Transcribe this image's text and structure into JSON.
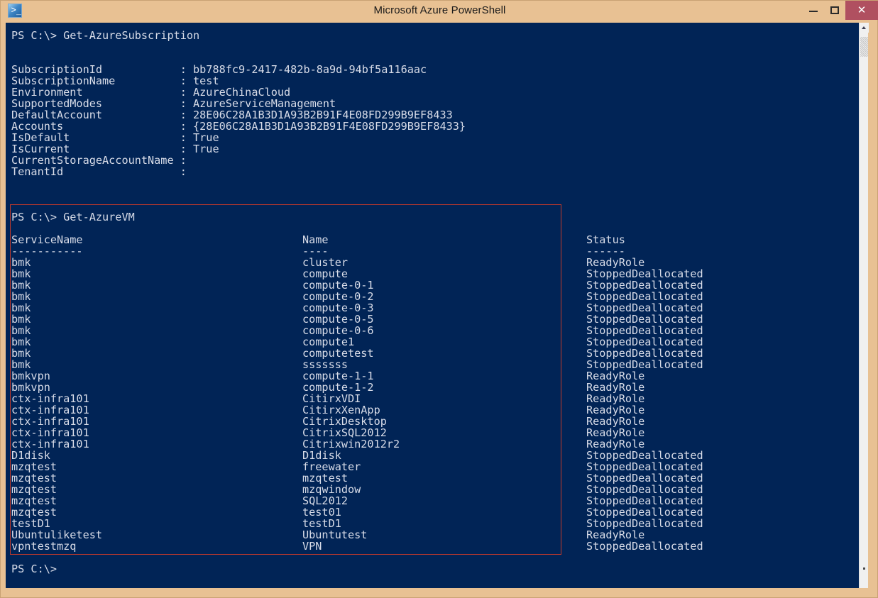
{
  "window": {
    "title": "Microsoft Azure PowerShell",
    "icon": "powershell-icon",
    "minimize_label": "–",
    "maximize_label": "❑",
    "close_label": "✕",
    "colors": {
      "frame": "#e8c193",
      "console_background": "#012456",
      "console_foreground": "#d8dce8",
      "close_button": "#b05060",
      "highlight_box_border": "#c0392b"
    }
  },
  "console": {
    "prompt": "PS C:\\>",
    "blocks": [
      {
        "name": "get-azuresubscription-block",
        "command_line": "PS C:\\> Get-AzureSubscription",
        "properties": [
          {
            "key": "SubscriptionId",
            "separator": ":",
            "value": "bb788fc9-2417-482b-8a9d-94bf5a116aac"
          },
          {
            "key": "SubscriptionName",
            "separator": ":",
            "value": "test"
          },
          {
            "key": "Environment",
            "separator": ":",
            "value": "AzureChinaCloud"
          },
          {
            "key": "SupportedModes",
            "separator": ":",
            "value": "AzureServiceManagement"
          },
          {
            "key": "DefaultAccount",
            "separator": ":",
            "value": "28E06C28A1B3D1A93B2B91F4E08FD299B9EF8433"
          },
          {
            "key": "Accounts",
            "separator": ":",
            "value": "{28E06C28A1B3D1A93B2B91F4E08FD299B9EF8433}"
          },
          {
            "key": "IsDefault",
            "separator": ":",
            "value": "True"
          },
          {
            "key": "IsCurrent",
            "separator": ":",
            "value": "True"
          },
          {
            "key": "CurrentStorageAccountName",
            "separator": ":",
            "value": ""
          },
          {
            "key": "TenantId",
            "separator": ":",
            "value": ""
          }
        ]
      },
      {
        "name": "get-azurevm-block",
        "command_line": "PS C:\\> Get-AzureVM",
        "highlighted": true,
        "table": {
          "headers": [
            "ServiceName",
            "Name",
            "Status"
          ],
          "rules": [
            "-----------",
            "----",
            "------"
          ],
          "rows": [
            [
              "bmk",
              "cluster",
              "ReadyRole"
            ],
            [
              "bmk",
              "compute",
              "StoppedDeallocated"
            ],
            [
              "bmk",
              "compute-0-1",
              "StoppedDeallocated"
            ],
            [
              "bmk",
              "compute-0-2",
              "StoppedDeallocated"
            ],
            [
              "bmk",
              "compute-0-3",
              "StoppedDeallocated"
            ],
            [
              "bmk",
              "compute-0-5",
              "StoppedDeallocated"
            ],
            [
              "bmk",
              "compute-0-6",
              "StoppedDeallocated"
            ],
            [
              "bmk",
              "compute1",
              "StoppedDeallocated"
            ],
            [
              "bmk",
              "computetest",
              "StoppedDeallocated"
            ],
            [
              "bmk",
              "sssssss",
              "StoppedDeallocated"
            ],
            [
              "bmkvpn",
              "compute-1-1",
              "ReadyRole"
            ],
            [
              "bmkvpn",
              "compute-1-2",
              "ReadyRole"
            ],
            [
              "ctx-infra101",
              "CitirxVDI",
              "ReadyRole"
            ],
            [
              "ctx-infra101",
              "CitirxXenApp",
              "ReadyRole"
            ],
            [
              "ctx-infra101",
              "CitrixDesktop",
              "ReadyRole"
            ],
            [
              "ctx-infra101",
              "CitrixSQL2012",
              "ReadyRole"
            ],
            [
              "ctx-infra101",
              "Citrixwin2012r2",
              "ReadyRole"
            ],
            [
              "D1disk",
              "D1disk",
              "StoppedDeallocated"
            ],
            [
              "mzqtest",
              "freewater",
              "StoppedDeallocated"
            ],
            [
              "mzqtest",
              "mzqtest",
              "StoppedDeallocated"
            ],
            [
              "mzqtest",
              "mzqwindow",
              "StoppedDeallocated"
            ],
            [
              "mzqtest",
              "SQL2012",
              "StoppedDeallocated"
            ],
            [
              "mzqtest",
              "test01",
              "StoppedDeallocated"
            ],
            [
              "testD1",
              "testD1",
              "StoppedDeallocated"
            ],
            [
              "Ubuntuliketest",
              "Ubuntutest",
              "ReadyRole"
            ],
            [
              "vpntestmzq",
              "VPN",
              "StoppedDeallocated"
            ]
          ]
        }
      }
    ],
    "final_prompt": "PS C:\\>"
  },
  "scrollbar": {
    "up_arrow": "scroll-up-icon",
    "thumb": "scroll-thumb"
  }
}
